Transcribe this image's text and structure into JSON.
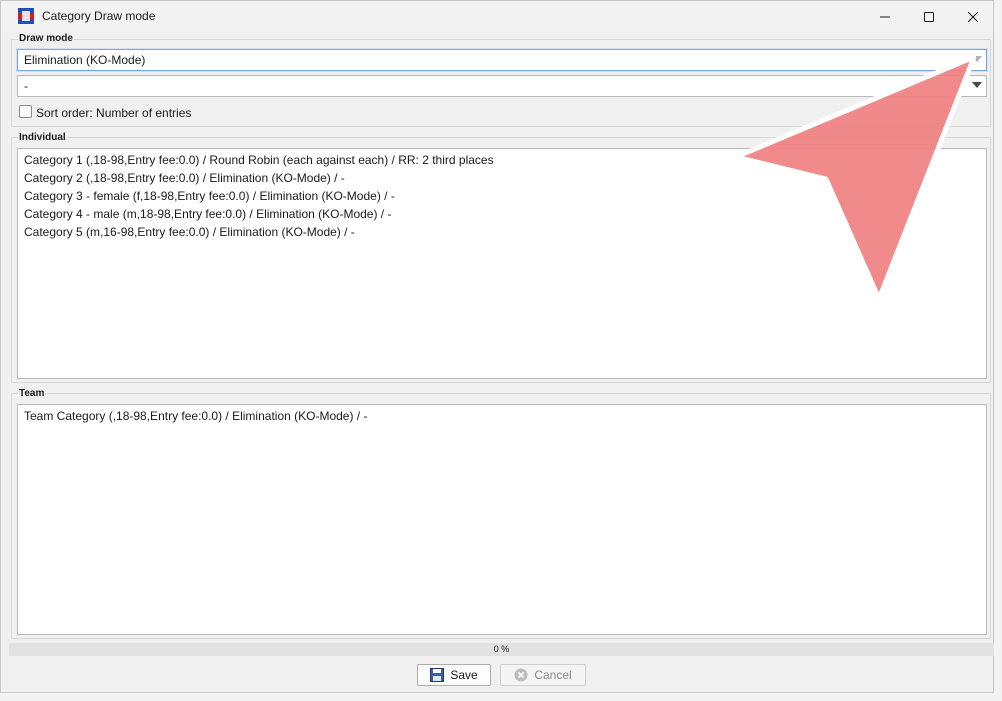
{
  "window": {
    "title": "Category Draw mode"
  },
  "draw_mode": {
    "group_label": "Draw mode",
    "mode_select_value": "Elimination (KO-Mode)",
    "secondary_select_value": "-",
    "sort_checkbox_label": "Sort order: Number of entries",
    "sort_checked": false
  },
  "individual": {
    "group_label": "Individual",
    "items": [
      "Category 1 (,18-98,Entry fee:0.0) / Round Robin (each against each) / RR: 2 third places",
      "Category 2 (,18-98,Entry fee:0.0) / Elimination (KO-Mode) / -",
      "Category 3 - female (f,18-98,Entry fee:0.0) / Elimination (KO-Mode) / -",
      "Category 4 - male (m,18-98,Entry fee:0.0) / Elimination (KO-Mode) / -",
      "Category 5 (m,16-98,Entry fee:0.0) / Elimination (KO-Mode) / -"
    ]
  },
  "team": {
    "group_label": "Team",
    "items": [
      "Team Category (,18-98,Entry fee:0.0) / Elimination (KO-Mode) / -"
    ]
  },
  "progress": {
    "percent": 0,
    "text": "0 %"
  },
  "buttons": {
    "save_label": "Save",
    "cancel_label": "Cancel"
  },
  "colors": {
    "cursor_fill": "#f08080",
    "progress_fill": "#4aa3df"
  }
}
